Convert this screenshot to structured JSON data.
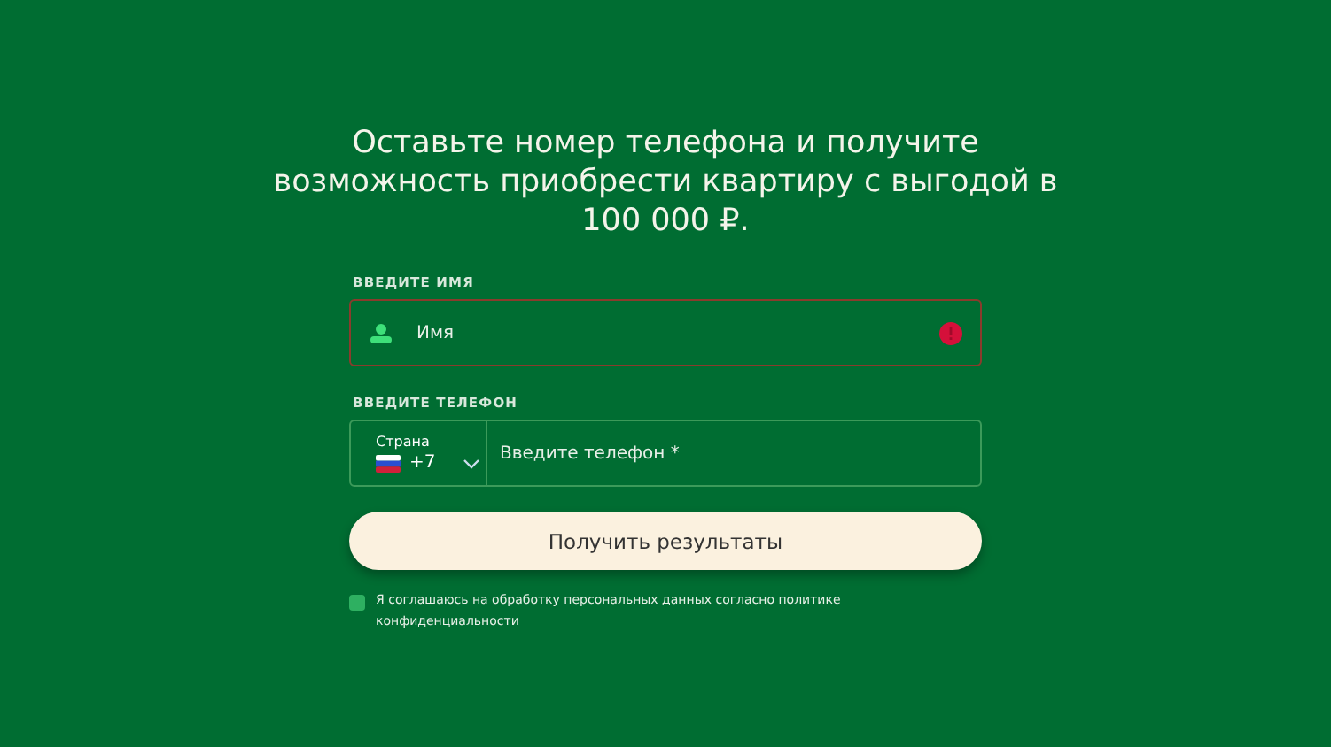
{
  "heading": "Оставьте номер телефона и получите возможность приобрести квартиру с выгодой в 100 000 ₽.",
  "name_field": {
    "label": "ВВЕДИТЕ ИМЯ",
    "placeholder": "Имя",
    "error": true
  },
  "phone_field": {
    "label": "ВВЕДИТЕ ТЕЛЕФОН",
    "country_label": "Страна",
    "code": "+7",
    "placeholder": "Введите телефон *"
  },
  "submit": "Получить результаты",
  "consent": {
    "text": "Я соглашаюсь на обработку персональных данных согласно политике конфиденциальности",
    "checked": false
  }
}
